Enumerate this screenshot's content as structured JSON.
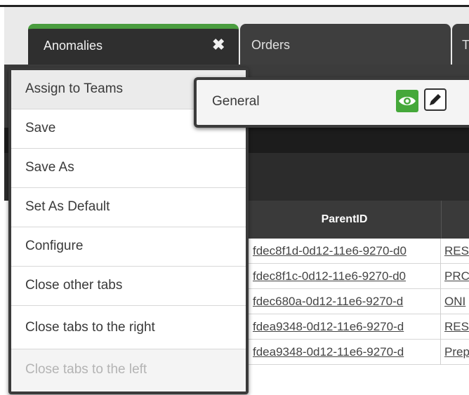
{
  "tabs": [
    {
      "label": "Anomalies",
      "close_glyph": "✖"
    },
    {
      "label": "Orders"
    },
    {
      "label": "T"
    }
  ],
  "menu": {
    "items": [
      {
        "label": "Assign to Teams"
      },
      {
        "label": "Save"
      },
      {
        "label": "Save As"
      },
      {
        "label": "Set As Default"
      },
      {
        "label": "Configure"
      },
      {
        "label": "Close other tabs"
      },
      {
        "label": "Close tabs to the right"
      },
      {
        "label": "Close tabs to the left"
      }
    ]
  },
  "submenu": {
    "label": "General",
    "icons": [
      "eye-icon",
      "pencil-icon"
    ]
  },
  "grid": {
    "columns": [
      "ParentID",
      ""
    ],
    "rows": [
      {
        "parent": "fdec8f1d-0d12-11e6-9270-d0",
        "next": "RES"
      },
      {
        "parent": "fdec8f1c-0d12-11e6-9270-d0",
        "next": "PRC"
      },
      {
        "parent": "fdec680a-0d12-11e6-9270-d",
        "next": "ONI"
      },
      {
        "parent": "fdea9348-0d12-11e6-9270-d",
        "next": "RES"
      },
      {
        "parent": "fdea9348-0d12-11e6-9270-d",
        "next": "Prep"
      }
    ]
  },
  "colors": {
    "accent_green": "#4a9d3f",
    "eye_button": "#45a83a",
    "dark_bg": "#3c3c3c"
  }
}
